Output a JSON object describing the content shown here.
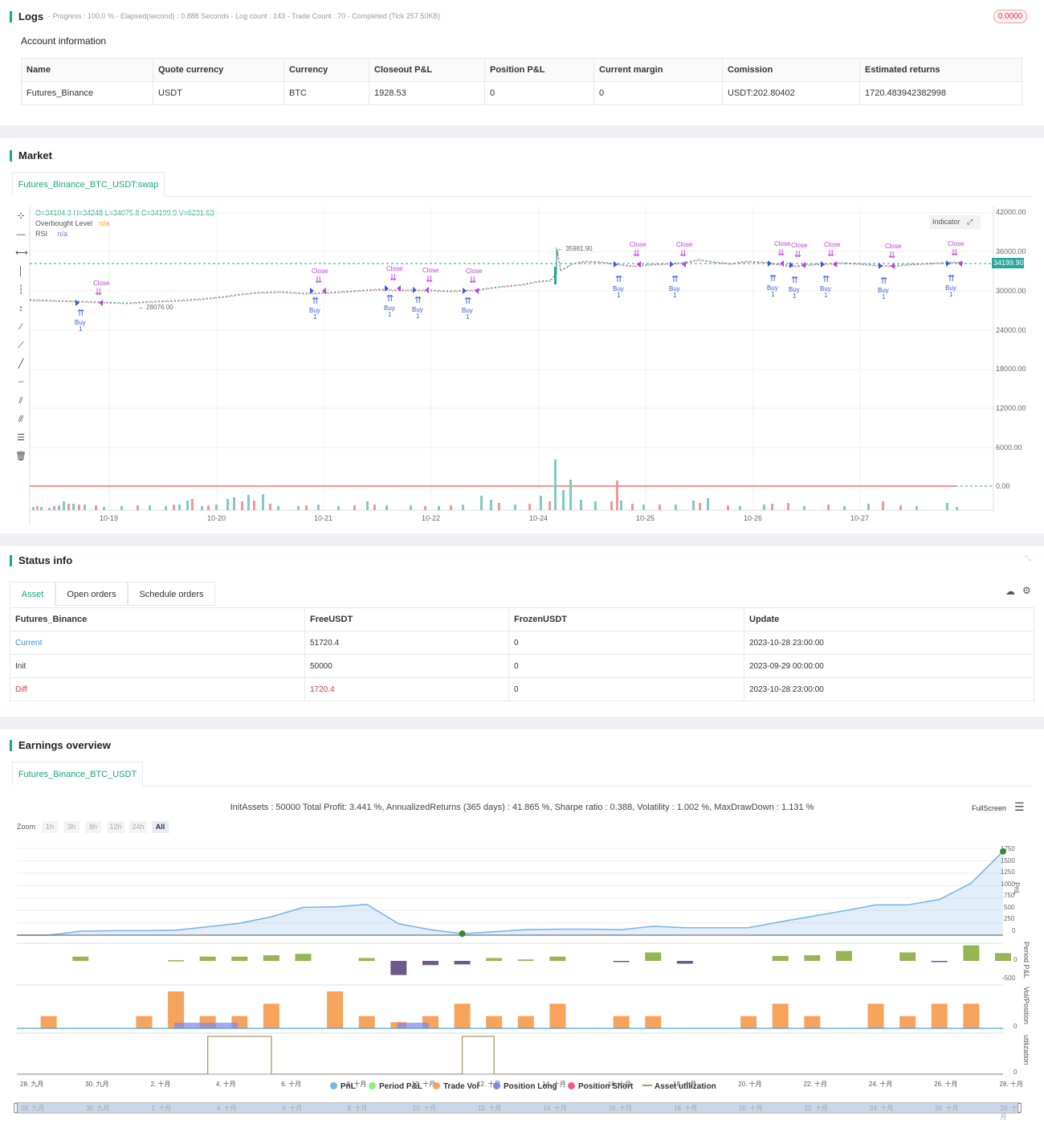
{
  "logs": {
    "title": "Logs",
    "summary": "- Progress : 100.0 % - Elapsed(second) : 0.888  Seconds - Log count : 143 - Trade Count : 70 - Completed (Tick 257.50KB)",
    "badge": "0.0000"
  },
  "account": {
    "title": "Account information",
    "headers": [
      "Name",
      "Quote currency",
      "Currency",
      "Closeout P&L",
      "Position P&L",
      "Current margin",
      "Comission",
      "Estimated returns"
    ],
    "row": [
      "Futures_Binance",
      "USDT",
      "BTC",
      "1928.53",
      "0",
      "0",
      "USDT:202.80402",
      "1720.483942382998"
    ]
  },
  "market": {
    "title": "Market",
    "tab": "Futures_Binance_BTC_USDT:swap",
    "ohlc": "O=34104.3 H=34248 L=34075.8 C=34199.9 V=6231.63",
    "legend_overbought": "Overbought Level",
    "legend_overbought_val": "n/a",
    "legend_rsi": "RSI",
    "legend_rsi_val": "n/a",
    "indicator_btn": "Indicator",
    "price_ticks": [
      "42000.00",
      "36000.00",
      "30000.00",
      "24000.00",
      "18000.00",
      "12000.00",
      "6000.00",
      "0.00"
    ],
    "current_price": "34199.90",
    "high_label": "35981.90",
    "low_label": "28076.00",
    "date_ticks": [
      "10-19",
      "10-20",
      "10-21",
      "10-22",
      "10-24",
      "10-25",
      "10-26",
      "10-27"
    ],
    "buy_label": "Buy",
    "close_label": "Close",
    "qty_label": "1"
  },
  "status": {
    "title": "Status info",
    "tabs": [
      "Asset",
      "Open orders",
      "Schedule orders"
    ],
    "headers": [
      "Futures_Binance",
      "FreeUSDT",
      "FrozenUSDT",
      "Update"
    ],
    "rows": [
      [
        "Current",
        "51720.4",
        "0",
        "2023-10-28 23:00:00"
      ],
      [
        "Init",
        "50000",
        "0",
        "2023-09-29 00:00:00"
      ],
      [
        "Diff",
        "1720.4",
        "0",
        "2023-10-28 23:00:00"
      ]
    ],
    "colors": {
      "current": "#3a8ee6",
      "diff": "#e0383e"
    }
  },
  "earnings": {
    "title": "Earnings overview",
    "tab": "Futures_Binance_BTC_USDT",
    "summary": "InitAssets : 50000 Total Profit: 3.441 %, AnnualizedReturns (365 days) : 41.865 %, Sharpe ratio : 0.388, Volatility : 1.002 %, MaxDrawDown : 1.131 %",
    "fullscreen": "FullScreen",
    "zoom_label": "Zoom",
    "zoom_options": [
      "1h",
      "3h",
      "8h",
      "12h",
      "24h",
      "All"
    ],
    "pnl_ticks": [
      "1750",
      "1500",
      "1250",
      "1000",
      "750",
      "500",
      "250",
      "0"
    ],
    "period_ticks": [
      "0",
      "-500"
    ],
    "vol_ticks": [
      "0"
    ],
    "util_ticks": [
      "0"
    ],
    "axis_titles": [
      "PnL",
      "Period P&L",
      "Vol/Position",
      "utilization"
    ],
    "date_ticks": [
      "28. 九月",
      "30. 九月",
      "2. 十月",
      "4. 十月",
      "6. 十月",
      "8. 十月",
      "10. 十月",
      "12. 十月",
      "14. 十月",
      "16. 十月",
      "18. 十月",
      "20. 十月",
      "22. 十月",
      "24. 十月",
      "26. 十月",
      "28. 十月"
    ],
    "legend": [
      {
        "label": "PnL",
        "color": "#7cb5ec"
      },
      {
        "label": "Period P&L",
        "color": "#90ed7d"
      },
      {
        "label": "Trade Vol",
        "color": "#f7a35c"
      },
      {
        "label": "Position Long",
        "color": "#8085e9"
      },
      {
        "label": "Position Short",
        "color": "#f15c80"
      },
      {
        "label": "Asset utilization",
        "color": "#a39a6b"
      }
    ]
  },
  "chart_data": [
    {
      "type": "line",
      "name": "PnL",
      "x": [
        "28. 九月",
        "29. 九月",
        "30. 九月",
        "1. 十月",
        "2. 十月",
        "3. 十月",
        "4. 十月",
        "5. 十月",
        "6. 十月",
        "7. 十月",
        "8. 十月",
        "9. 十月",
        "10. 十月",
        "11. 十月",
        "12. 十月",
        "13. 十月",
        "14. 十月",
        "15. 十月",
        "16. 十月",
        "17. 十月",
        "18. 十月",
        "19. 十月",
        "20. 十月",
        "21. 十月",
        "22. 十月",
        "23. 十月",
        "24. 十月",
        "25. 十月",
        "26. 十月",
        "27. 十月",
        "28. 十月",
        "28.5 十月"
      ],
      "y": [
        0,
        0,
        80,
        90,
        90,
        100,
        170,
        240,
        370,
        560,
        570,
        620,
        230,
        110,
        30,
        70,
        110,
        120,
        120,
        110,
        180,
        150,
        150,
        150,
        270,
        380,
        490,
        610,
        610,
        720,
        1050,
        1690
      ],
      "ylim": [
        0,
        1750
      ]
    },
    {
      "type": "bar",
      "name": "Period P&L",
      "values": [
        0,
        0,
        60,
        0,
        0,
        10,
        60,
        60,
        80,
        100,
        0,
        40,
        -200,
        -60,
        -50,
        40,
        20,
        60,
        0,
        -10,
        120,
        -40,
        0,
        0,
        70,
        80,
        140,
        0,
        120,
        -10,
        220,
        110
      ],
      "ylim": [
        -500,
        400
      ]
    },
    {
      "type": "bar",
      "name": "Trade Vol",
      "values": [
        0,
        1,
        0,
        0,
        1,
        3,
        1,
        1,
        2,
        0,
        3,
        1,
        0.5,
        1,
        2,
        1,
        1,
        2,
        0,
        1,
        1,
        0,
        0,
        1,
        2,
        1,
        0,
        2,
        1,
        2,
        2,
        0
      ],
      "ylim": [
        0,
        3.5
      ]
    },
    {
      "type": "area",
      "name": "Asset utilization",
      "values": [
        0,
        0,
        0,
        0,
        0,
        0,
        1,
        1,
        0,
        0,
        0,
        0,
        0,
        0,
        1,
        0,
        0,
        0,
        0,
        0,
        0,
        0,
        0,
        0,
        0,
        0,
        0,
        0,
        0,
        0,
        0,
        0
      ],
      "ylim": [
        0,
        1.2
      ]
    }
  ]
}
